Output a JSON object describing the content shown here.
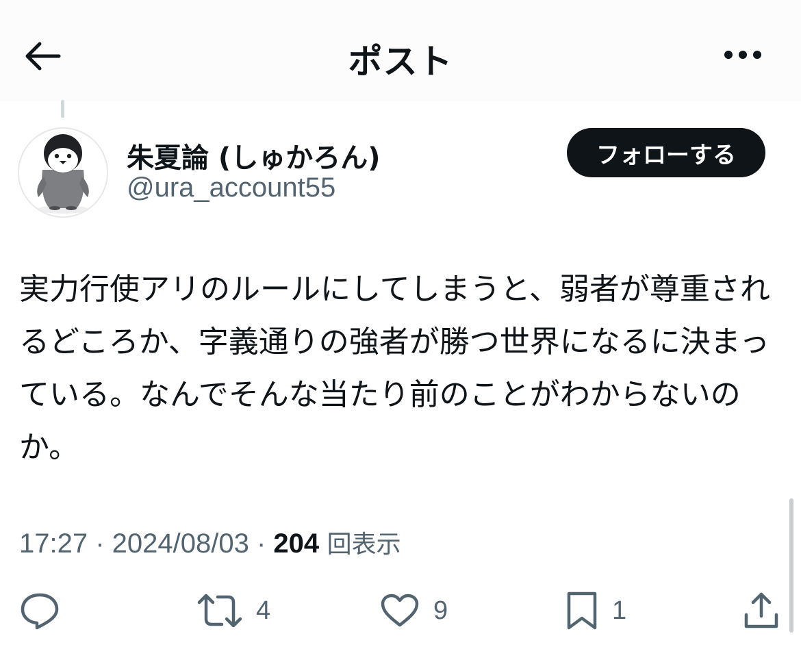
{
  "header": {
    "title": "ポスト",
    "back_icon": "arrow-left-icon",
    "more_icon": "more-horizontal-icon"
  },
  "author": {
    "display_name": "朱夏論 (しゅかろん)",
    "handle": "@ura_account55",
    "avatar_icon": "penguin-avatar",
    "follow_label": "フォローする"
  },
  "post": {
    "text": "実力行使アリのルールにしてしまうと、弱者が尊重されるどころか、字義通りの強者が勝つ世界になるに決まっている。なんでそんな当たり前のことがわからないのか。"
  },
  "meta": {
    "time": "17:27",
    "sep1": " · ",
    "date": "2024/08/03",
    "sep2": " · ",
    "views": "204",
    "views_label": " 回表示"
  },
  "actions": {
    "reply_icon": "reply-icon",
    "retweet_icon": "retweet-icon",
    "retweet_count": "4",
    "like_icon": "heart-icon",
    "like_count": "9",
    "bookmark_icon": "bookmark-icon",
    "bookmark_count": "1",
    "share_icon": "share-icon"
  },
  "colors": {
    "text": "#0f1419",
    "secondary": "#536471",
    "follow_bg": "#0f1419",
    "follow_text": "#ffffff"
  }
}
